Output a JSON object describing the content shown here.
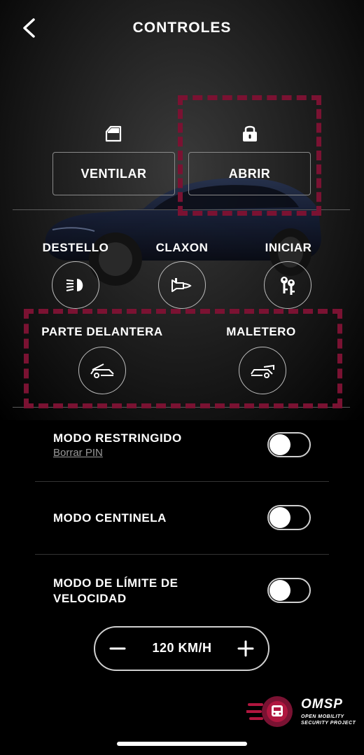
{
  "header": {
    "title": "CONTROLES",
    "back_icon": "chevron-left-icon"
  },
  "top_actions": [
    {
      "label": "VENTILAR",
      "icon": "window-icon"
    },
    {
      "label": "ABRIR",
      "icon": "lock-icon"
    }
  ],
  "quick_controls": [
    {
      "label": "DESTELLO",
      "icon": "headlight-icon"
    },
    {
      "label": "CLAXON",
      "icon": "horn-icon"
    },
    {
      "label": "INICIAR",
      "icon": "keys-icon"
    }
  ],
  "trunk_controls": [
    {
      "label": "PARTE DELANTERA",
      "icon": "frunk-icon"
    },
    {
      "label": "MALETERO",
      "icon": "trunk-icon"
    }
  ],
  "settings": [
    {
      "label_lines": [
        "MODO RESTRINGIDO"
      ],
      "link": "Borrar PIN",
      "enabled": false
    },
    {
      "label_lines": [
        "MODO CENTINELA"
      ],
      "enabled": false
    },
    {
      "label_lines": [
        "MODO DE LÍMITE DE",
        "VELOCIDAD"
      ],
      "enabled": false
    }
  ],
  "speed_limit": {
    "value": "120 KM/H",
    "minus": "−",
    "plus": "+"
  },
  "watermark": {
    "title": "OMSP",
    "line1": "OPEN MOBILITY",
    "line2": "SECURITY PROJECT"
  },
  "colors": {
    "highlight": "#7a1232",
    "background": "#000000",
    "text": "#ffffff"
  }
}
